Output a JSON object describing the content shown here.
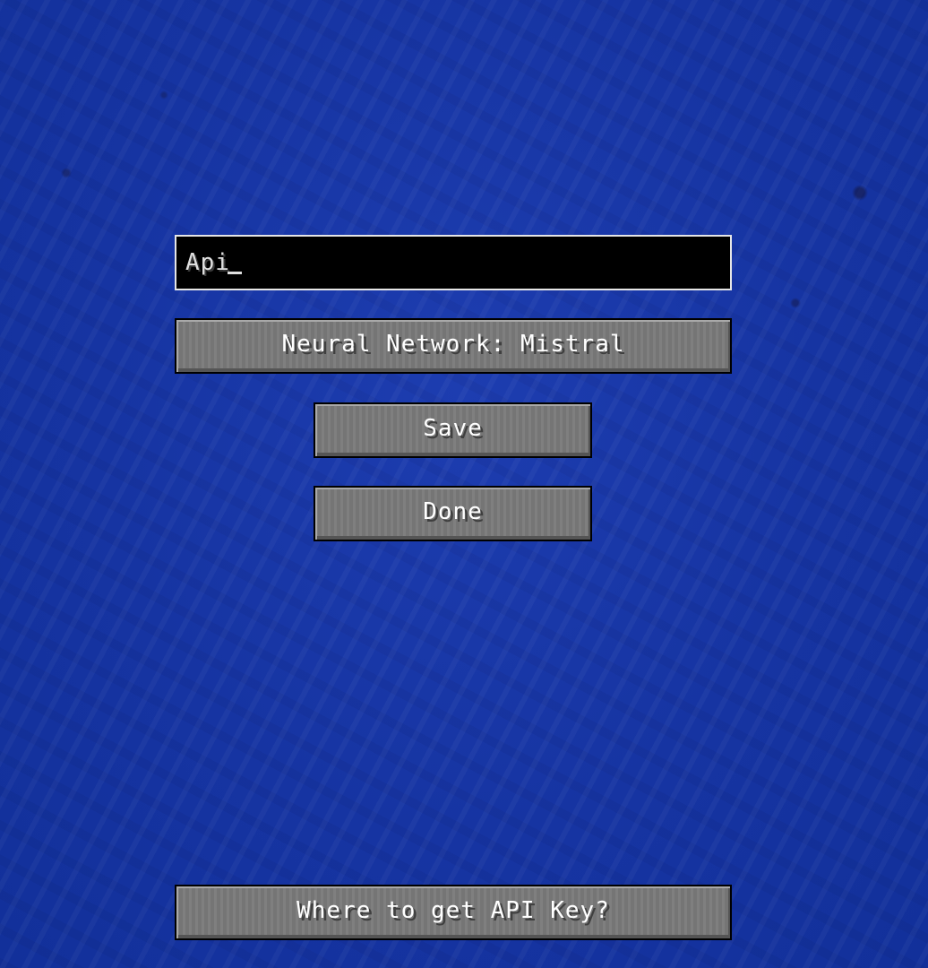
{
  "api_field": {
    "value": "Api"
  },
  "buttons": {
    "neural_network": "Neural Network: Mistral",
    "save": "Save",
    "done": "Done",
    "where_api_key": "Where to get API Key?"
  },
  "colors": {
    "background": "#1533a0",
    "button_face": "#7a7a7a",
    "field_background": "#000000",
    "field_border": "#e6e6e6",
    "text": "#ffffff"
  }
}
